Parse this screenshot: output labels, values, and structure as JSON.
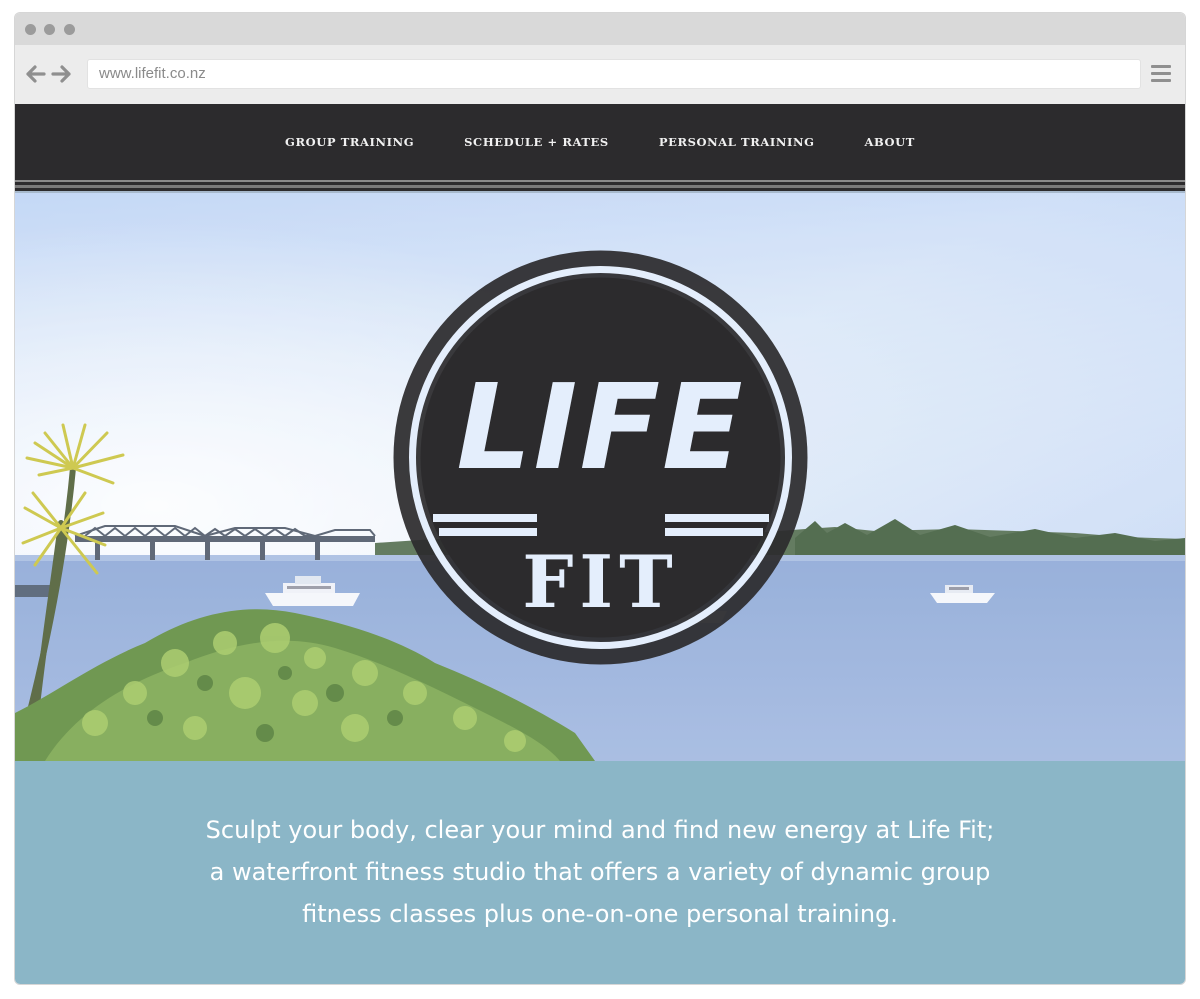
{
  "browser": {
    "url": "www.lifefit.co.nz",
    "icons": {
      "back": "arrow-left-icon",
      "forward": "arrow-right-icon",
      "menu": "hamburger-menu-icon"
    }
  },
  "nav": {
    "items": [
      {
        "label": "GROUP TRAINING"
      },
      {
        "label": "SCHEDULE + RATES"
      },
      {
        "label": "PERSONAL TRAINING"
      },
      {
        "label": "ABOUT"
      }
    ]
  },
  "hero": {
    "logo": {
      "line1": "LIFE",
      "line2": "FIT"
    }
  },
  "tagline": {
    "text": "Sculpt your body, clear your mind and find new energy at Life Fit; a waterfront fitness studio that offers a variety of dynamic group fitness classes plus one-on-one personal training."
  },
  "colors": {
    "nav_bg": "#2c2b2d",
    "tagline_bg": "#8bb6c7",
    "logo_dark": "#2c2b2d",
    "logo_light": "#e4eefc"
  }
}
